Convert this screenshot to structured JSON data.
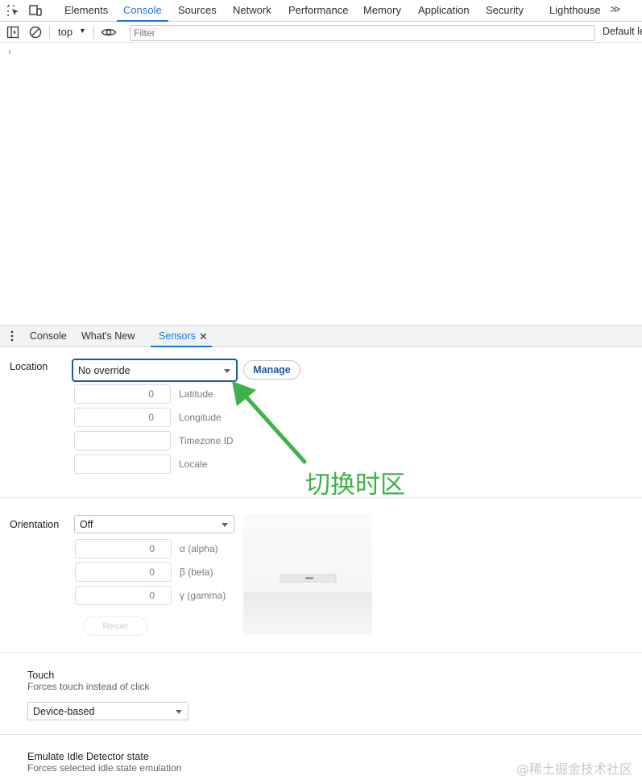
{
  "tabs": {
    "items": [
      "Elements",
      "Console",
      "Sources",
      "Network",
      "Performance",
      "Memory",
      "Application",
      "Security",
      "Lighthouse"
    ],
    "active": "Console",
    "more_label": ">>"
  },
  "toolbar": {
    "context": "top",
    "filter_placeholder": "Filter",
    "levels_label": "Default le"
  },
  "console": {
    "prompt": "›"
  },
  "drawer": {
    "tabs": [
      "Console",
      "What's New",
      "Sensors"
    ],
    "active": "Sensors",
    "close_label": "✕"
  },
  "sensors": {
    "location": {
      "label": "Location",
      "select_value": "No override",
      "manage_label": "Manage",
      "latitude": {
        "value": "0",
        "label": "Latitude"
      },
      "longitude": {
        "value": "0",
        "label": "Longitude"
      },
      "timezone": {
        "value": "",
        "label": "Timezone ID"
      },
      "locale": {
        "value": "",
        "label": "Locale"
      }
    },
    "orientation": {
      "label": "Orientation",
      "select_value": "Off",
      "alpha": {
        "value": "0",
        "label": "α (alpha)"
      },
      "beta": {
        "value": "0",
        "label": "β (beta)"
      },
      "gamma": {
        "value": "0",
        "label": "γ (gamma)"
      },
      "reset_label": "Reset"
    },
    "touch": {
      "title": "Touch",
      "description": "Forces touch instead of click",
      "select_value": "Device-based"
    },
    "idle": {
      "title": "Emulate Idle Detector state",
      "description": "Forces selected idle state emulation"
    }
  },
  "annotation": {
    "text": "切换时区",
    "color": "#3fb24a"
  },
  "watermark": "@稀土掘金技术社区",
  "colors": {
    "accent": "#1a73e8",
    "focus_border": "#1a57a8"
  }
}
